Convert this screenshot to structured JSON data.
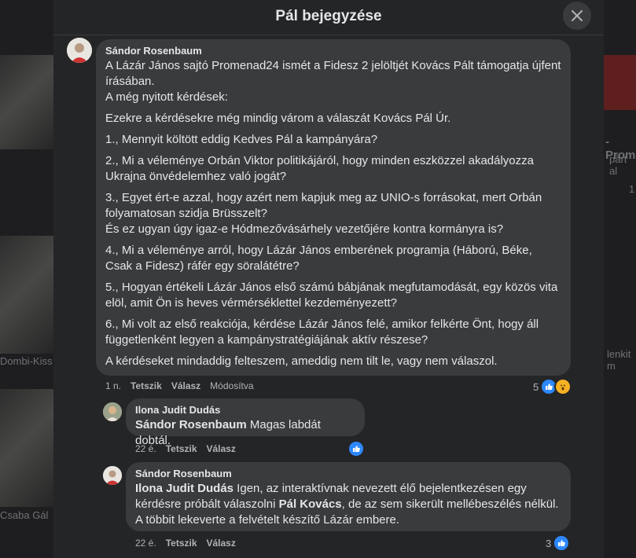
{
  "modal": {
    "title": "Pál bejegyzése"
  },
  "background": {
    "snippets": [
      "- Prom",
      "pårt al",
      "1",
      "lenkit m",
      "Dombi-Kiss",
      "Csaba Gál"
    ]
  },
  "comments": [
    {
      "author": "Sándor Rosenbaum",
      "lines": [
        "A Lázár János sajtó Promenad24 ismét a Fidesz 2 jelöltjét Kovács Pált támogatja újfent írásában.",
        "A még nyitott kérdések:",
        "Ezekre a kérdésekre még mindig várom a válaszát Kovács Pál Úr.",
        "1., Mennyit költött eddig Kedves Pál a kampányára?",
        "2., Mi a véleménye Orbán Viktor politikájáról, hogy minden eszközzel akadályozza Ukrajna önvédelemhez való jogát?",
        "3., Egyet ért-e azzal, hogy azért nem kapjuk meg az UNIO-s forrásokat, mert Orbán folyamatosan szidja Brüsszelt?",
        "És ez ugyan úgy igaz-e Hódmezővásárhely vezetőjére kontra kormányra is?",
        "4., Mi a véleménye arról, hogy Lázár János emberének programja (Háború, Béke, Csak a Fidesz) ráfér egy söralátétre?",
        "5., Hogyan értékeli Lázár János első számú bábjának megfutamodását, egy közös vita elöl, amit Ön is heves vérmérséklettel kezdeményezett?",
        "6., Mi volt az első reakciója, kérdése Lázár János felé, amikor felkérte Önt, hogy áll függetlenként legyen a kampánystratégiájának aktív részese?",
        "A kérdéseket mindaddig felteszem, ameddig nem tilt le, vagy nem válaszol."
      ],
      "time": "1 n.",
      "like_label": "Tetszik",
      "reply_label": "Válasz",
      "edited_label": "Módosítva",
      "reaction_count": "5"
    },
    {
      "author": "Ilona Judit Dudás",
      "mention": "Sándor Rosenbaum",
      "text": " Magas labdát dobtál.",
      "time": "22 é.",
      "like_label": "Tetszik",
      "reply_label": "Válasz"
    },
    {
      "author": "Sándor Rosenbaum",
      "mention": "Ilona Judit Dudás",
      "text_a": " Igen, az interaktívnak nevezett élő bejelentkezésen egy kérdésre próbált válaszolni ",
      "mention2": "Pál Kovács",
      "text_b": ", de az sem sikerült mellébeszélés nélkül.",
      "text_c": "A többit lekeverte a felvételt készítő Lázár embere.",
      "time": "22 é.",
      "like_label": "Tetszik",
      "reply_label": "Válasz",
      "reaction_count": "3"
    }
  ],
  "colors": {
    "like": "#2d88ff",
    "wow": "#f7b125",
    "bubble": "#3a3b3c",
    "modal": "#242526"
  },
  "icons": {
    "close": "close-icon",
    "like": "like-icon",
    "wow": "wow-icon"
  }
}
